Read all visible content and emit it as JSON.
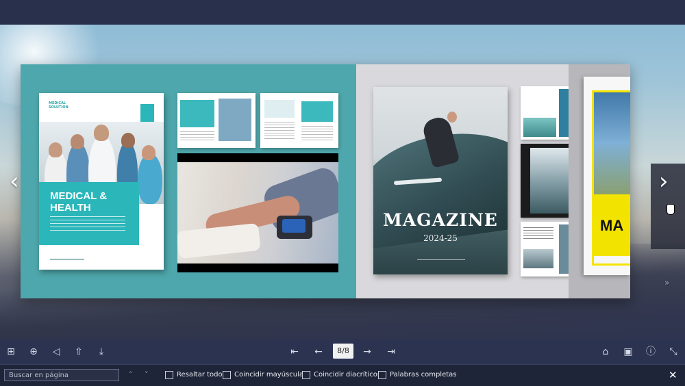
{
  "viewer": {
    "page_indicator": "8/8",
    "nav_prev": "‹",
    "nav_next": "›",
    "nav_next_small": "»"
  },
  "book": {
    "medical_cover": {
      "brand": "MEDICAL\nSOLUTION",
      "title": "MEDICAL &\nHEALTH"
    },
    "magazine_cover": {
      "title": "MAGAZINE",
      "year": "2024-25"
    },
    "yellow_cover": {
      "title": "MA"
    }
  },
  "toolbar": {
    "left_icons": [
      "grid-icon",
      "zoom-in-icon",
      "sound-icon",
      "share-icon",
      "download-icon"
    ],
    "center_icons": [
      "first-page-icon",
      "prev-page-icon",
      "next-page-icon",
      "last-page-icon"
    ],
    "right_icons": [
      "home-icon",
      "table-of-contents-icon",
      "info-icon",
      "fullscreen-icon"
    ],
    "glyphs": {
      "grid": "⊞",
      "zoom": "⊕",
      "sound": "◁",
      "share": "⇧",
      "download": "⤓",
      "first": "⇤",
      "prev": "←",
      "next": "→",
      "last": "⇥",
      "home": "⌂",
      "toc": "▣",
      "info": "ⓘ",
      "fullscreen": "⤡"
    }
  },
  "findbar": {
    "placeholder": "Buscar en página",
    "up": "˄",
    "down": "˅",
    "options": [
      "Resaltar todo",
      "Coincidir mayúsculas",
      "Coincidir diacríticos",
      "Palabras completas"
    ],
    "close": "✕"
  }
}
